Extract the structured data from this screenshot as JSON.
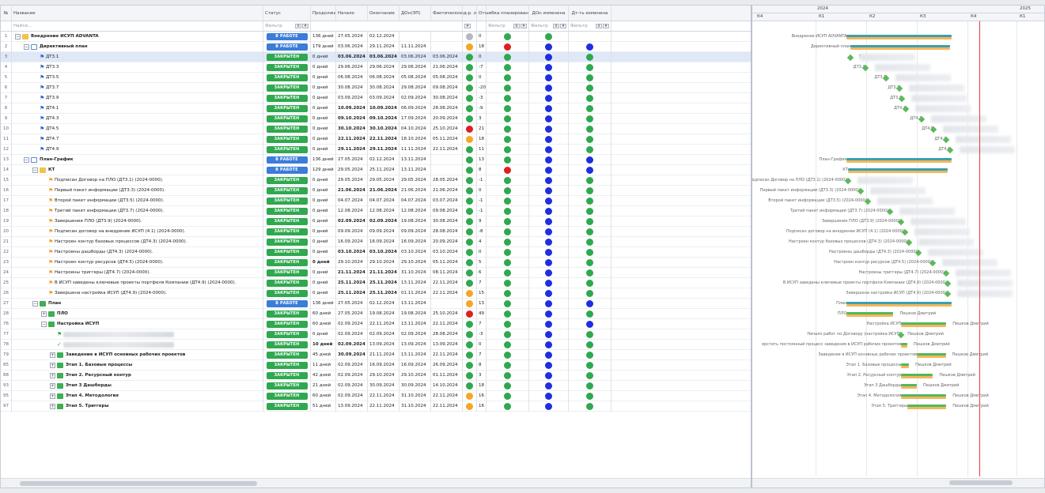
{
  "columns": {
    "num": "№",
    "name": "Название",
    "status": "Статус",
    "duration": "Продолжительность",
    "start": "Начало",
    "end": "Окончание",
    "dd": "ДОн(ЭП)",
    "fact": "Фактическое ок",
    "ind": "Инд-р. отк",
    "dev": "Откло",
    "err": "Ошибка планирования",
    "ddch": "ДОн изменена",
    "dtch": "Дт-ть изменена"
  },
  "filters": {
    "search_placeholder": "Найти...",
    "filter_placeholder": "Фильтр",
    "btn_x": "x",
    "btn_dd": "▾"
  },
  "status_labels": {
    "work": "В РАБОТЕ",
    "closed": "ЗАКРЫТЕН"
  },
  "colors": {
    "green": "#2fa84f",
    "blue": "#1f2ee0",
    "red": "#e01f1f",
    "orange": "#f5a623",
    "grey": "#b5b9bf"
  },
  "rows": [
    {
      "num": "1",
      "name": "Внедрение ИСУП ADVANTA",
      "level": 0,
      "icon": "folder",
      "exp": "−",
      "bold": true,
      "status": "work",
      "dur": "136 дней",
      "start": "27.05.2024",
      "end": "02.12.2024",
      "dd": "",
      "fact": "",
      "ind": "grey",
      "dev": "0",
      "err": "green",
      "ddch": "green",
      "dtch": ""
    },
    {
      "num": "2",
      "name": "Директивный план",
      "level": 1,
      "icon": "folder-open",
      "exp": "−",
      "bold": true,
      "status": "work",
      "dur": "179 дней",
      "start": "03.06.2024",
      "end": "29.11.2024",
      "dd": "11.11.2024",
      "fact": "",
      "ind": "orange",
      "dev": "18",
      "err": "red",
      "ddch": "blue",
      "dtch": "blue"
    },
    {
      "num": "3",
      "name": "ДТ3.1",
      "level": 2,
      "icon": "flag-blue",
      "bold": false,
      "sel": true,
      "status": "closed",
      "dur": "0 дней",
      "start": "03.06.2024",
      "end": "03.06.2024",
      "dd": "03.06.2024",
      "fact": "03.06.2024",
      "ind": "green",
      "dev": "0",
      "err": "green",
      "ddch": "blue",
      "dtch": "green",
      "bolddates": true
    },
    {
      "num": "4",
      "name": "ДТ3.3",
      "level": 2,
      "icon": "flag-blue",
      "status": "closed",
      "dur": "0 дней",
      "start": "29.06.2024",
      "end": "29.06.2024",
      "dd": "29.06.2024",
      "fact": "21.06.2024",
      "ind": "green",
      "dev": "-7",
      "err": "green",
      "ddch": "blue",
      "dtch": "green"
    },
    {
      "num": "5",
      "name": "ДТ3.5",
      "level": 2,
      "icon": "flag-blue",
      "status": "closed",
      "dur": "0 дней",
      "start": "06.08.2024",
      "end": "06.08.2024",
      "dd": "05.08.2024",
      "fact": "05.08.2024",
      "ind": "green",
      "dev": "0",
      "err": "green",
      "ddch": "blue",
      "dtch": "green"
    },
    {
      "num": "6",
      "name": "ДТ3.7",
      "level": 2,
      "icon": "flag-blue",
      "status": "closed",
      "dur": "0 дней",
      "start": "30.08.2024",
      "end": "30.08.2024",
      "dd": "29.08.2024",
      "fact": "09.08.2024",
      "ind": "green",
      "dev": "-20",
      "err": "green",
      "ddch": "blue",
      "dtch": "green"
    },
    {
      "num": "7",
      "name": "ДТ3.9",
      "level": 2,
      "icon": "flag-blue",
      "status": "closed",
      "dur": "0 дней",
      "start": "03.09.2024",
      "end": "03.09.2024",
      "dd": "02.09.2024",
      "fact": "30.08.2024",
      "ind": "green",
      "dev": "-3",
      "err": "green",
      "ddch": "blue",
      "dtch": "green"
    },
    {
      "num": "8",
      "name": "ДТ4.1",
      "level": 2,
      "icon": "flag-blue",
      "status": "closed",
      "dur": "0 дней",
      "start": "10.09.2024",
      "end": "10.09.2024",
      "dd": "06.09.2024",
      "fact": "28.08.2024",
      "ind": "green",
      "dev": "-9",
      "err": "green",
      "ddch": "blue",
      "dtch": "green",
      "bolddates": true
    },
    {
      "num": "9",
      "name": "ДТ4.3",
      "level": 2,
      "icon": "flag-blue",
      "status": "closed",
      "dur": "0 дней",
      "start": "09.10.2024",
      "end": "09.10.2024",
      "dd": "17.09.2024",
      "fact": "20.09.2024",
      "ind": "green",
      "dev": "3",
      "err": "green",
      "ddch": "blue",
      "dtch": "green",
      "bolddates": true
    },
    {
      "num": "10",
      "name": "ДТ4.5",
      "level": 2,
      "icon": "flag-blue",
      "status": "closed",
      "dur": "0 дней",
      "start": "30.10.2024",
      "end": "30.10.2024",
      "dd": "04.10.2024",
      "fact": "25.10.2024",
      "ind": "red",
      "dev": "21",
      "err": "green",
      "ddch": "blue",
      "dtch": "green",
      "bolddates": true
    },
    {
      "num": "11",
      "name": "ДТ4.7",
      "level": 2,
      "icon": "flag-blue",
      "status": "closed",
      "dur": "0 дней",
      "start": "22.11.2024",
      "end": "22.11.2024",
      "dd": "18.10.2024",
      "fact": "05.11.2024",
      "ind": "orange",
      "dev": "18",
      "err": "green",
      "ddch": "blue",
      "dtch": "green",
      "bolddates": true
    },
    {
      "num": "12",
      "name": "ДТ4.9",
      "level": 2,
      "icon": "flag-blue",
      "status": "closed",
      "dur": "0 дней",
      "start": "29.11.2024",
      "end": "29.11.2024",
      "dd": "11.11.2024",
      "fact": "22.11.2024",
      "ind": "green",
      "dev": "11",
      "err": "green",
      "ddch": "blue",
      "dtch": "green",
      "bolddates": true
    },
    {
      "num": "13",
      "name": "План-График",
      "level": 1,
      "icon": "folder-open",
      "exp": "−",
      "bold": true,
      "status": "work",
      "dur": "136 дней",
      "start": "27.05.2024",
      "end": "02.12.2024",
      "dd": "13.11.2024",
      "fact": "",
      "ind": "green",
      "dev": "13",
      "err": "green",
      "ddch": "blue",
      "dtch": "blue"
    },
    {
      "num": "14",
      "name": "КТ",
      "level": 2,
      "icon": "folder",
      "exp": "−",
      "bold": true,
      "status": "work",
      "dur": "129 дней",
      "start": "29.05.2024",
      "end": "25.11.2024",
      "dd": "13.11.2024",
      "fact": "",
      "ind": "green",
      "dev": "8",
      "err": "red",
      "ddch": "blue",
      "dtch": "blue"
    },
    {
      "num": "15",
      "name": "Подписан Договор на ПЛО (ДТ3.1) (2024-0000).",
      "level": 3,
      "icon": "flag-orange",
      "status": "closed",
      "dur": "0 дней",
      "start": "29.05.2024",
      "end": "29.05.2024",
      "dd": "29.05.2024",
      "fact": "28.05.2024",
      "ind": "green",
      "dev": "-1",
      "err": "green",
      "ddch": "blue",
      "dtch": "green"
    },
    {
      "num": "16",
      "name": "Первый пакет информации (ДТ3.3) (2024-0000).",
      "level": 3,
      "icon": "flag-orange",
      "status": "closed",
      "dur": "0 дней",
      "start": "21.06.2024",
      "end": "21.06.2024",
      "dd": "21.06.2024",
      "fact": "21.06.2024",
      "ind": "green",
      "dev": "0",
      "err": "green",
      "ddch": "blue",
      "dtch": "green",
      "bolddates": true
    },
    {
      "num": "17",
      "name": "Второй пакет информации (ДТ3.5) (2024-0000).",
      "level": 3,
      "icon": "flag-orange",
      "status": "closed",
      "dur": "0 дней",
      "start": "04.07.2024",
      "end": "04.07.2024",
      "dd": "04.07.2024",
      "fact": "03.07.2024",
      "ind": "green",
      "dev": "-1",
      "err": "green",
      "ddch": "blue",
      "dtch": "green"
    },
    {
      "num": "18",
      "name": "Третий пакет информации (ДТ3.7) (2024-0000).",
      "level": 3,
      "icon": "flag-orange",
      "status": "closed",
      "dur": "0 дней",
      "start": "12.08.2024",
      "end": "12.08.2024",
      "dd": "12.08.2024",
      "fact": "09.08.2024",
      "ind": "green",
      "dev": "-1",
      "err": "green",
      "ddch": "blue",
      "dtch": "green"
    },
    {
      "num": "19",
      "name": "Завершение ПЛО (ДТ3.9) (2024-0000).",
      "level": 3,
      "icon": "flag-orange",
      "status": "closed",
      "dur": "0 дней",
      "start": "02.09.2024",
      "end": "02.09.2024",
      "dd": "19.08.2024",
      "fact": "30.08.2024",
      "ind": "green",
      "dev": "9",
      "err": "green",
      "ddch": "blue",
      "dtch": "green",
      "bolddates": true
    },
    {
      "num": "20",
      "name": "Подписан договор на внедрение ИСУП (4.1) (2024-0000).",
      "level": 3,
      "icon": "flag-orange",
      "status": "closed",
      "dur": "0 дней",
      "start": "09.09.2024",
      "end": "09.09.2024",
      "dd": "09.09.2024",
      "fact": "28.08.2024",
      "ind": "green",
      "dev": "-8",
      "err": "green",
      "ddch": "blue",
      "dtch": "green"
    },
    {
      "num": "21",
      "name": "Настроен контур базовых процессов (ДТ4.3) (2024-0000).",
      "level": 3,
      "icon": "flag-orange",
      "status": "closed",
      "dur": "0 дней",
      "start": "16.09.2024",
      "end": "16.09.2024",
      "dd": "16.09.2024",
      "fact": "20.09.2024",
      "ind": "green",
      "dev": "4",
      "err": "green",
      "ddch": "blue",
      "dtch": "green"
    },
    {
      "num": "22",
      "name": "Настроены дашборды (ДТ4.3) (2024-0000).",
      "level": 3,
      "icon": "flag-orange",
      "status": "closed",
      "dur": "0 дней",
      "start": "03.10.2024",
      "end": "03.10.2024",
      "dd": "03.10.2024",
      "fact": "03.10.2024",
      "ind": "green",
      "dev": "0",
      "err": "green",
      "ddch": "blue",
      "dtch": "green",
      "bolddates": true
    },
    {
      "num": "23",
      "name": "Настроен контур ресурсов (ДТ4.5) (2024-0000).",
      "level": 3,
      "icon": "flag-orange",
      "status": "closed",
      "dur": "0 дней",
      "start": "29.10.2024",
      "end": "29.10.2024",
      "dd": "29.10.2024",
      "fact": "05.11.2024",
      "ind": "green",
      "dev": "5",
      "err": "green",
      "ddch": "blue",
      "dtch": "green",
      "bolddur": true
    },
    {
      "num": "24",
      "name": "Настроены триггеры (ДТ4.7) (2024-0000).",
      "level": 3,
      "icon": "flag-orange",
      "status": "closed",
      "dur": "0 дней",
      "start": "21.11.2024",
      "end": "21.11.2024",
      "dd": "31.10.2024",
      "fact": "08.11.2024",
      "ind": "green",
      "dev": "6",
      "err": "green",
      "ddch": "blue",
      "dtch": "green",
      "bolddates": true
    },
    {
      "num": "25",
      "name": "В ИСУП заведены ключевые проекты портфеля Компании (ДТ4.9) (2024-0000).",
      "level": 3,
      "icon": "flag-orange",
      "status": "closed",
      "dur": "0 дней",
      "start": "25.11.2024",
      "end": "25.11.2024",
      "dd": "13.11.2024",
      "fact": "22.11.2024",
      "ind": "green",
      "dev": "7",
      "err": "green",
      "ddch": "blue",
      "dtch": "green",
      "bolddates": true
    },
    {
      "num": "26",
      "name": "Завершена настройка ИСУП (ДТ4.9) (2024-0000).",
      "level": 3,
      "icon": "flag-orange",
      "status": "closed",
      "dur": "0 дней",
      "start": "25.11.2024",
      "end": "25.11.2024",
      "dd": "01.11.2024",
      "fact": "22.11.2024",
      "ind": "orange",
      "dev": "15",
      "err": "green",
      "ddch": "blue",
      "dtch": "green",
      "bolddates": true
    },
    {
      "num": "27",
      "name": "План",
      "level": 2,
      "icon": "folder-green",
      "exp": "−",
      "bold": true,
      "status": "work",
      "dur": "136 дней",
      "start": "27.05.2024",
      "end": "02.12.2024",
      "dd": "13.11.2024",
      "fact": "",
      "ind": "orange",
      "dev": "13",
      "err": "green",
      "ddch": "blue",
      "dtch": "blue"
    },
    {
      "num": "28",
      "name": "ПЛО",
      "level": 3,
      "icon": "folder-green",
      "exp": "+",
      "bold": true,
      "status": "closed",
      "dur": "60 дней",
      "start": "27.05.2024",
      "end": "19.08.2024",
      "dd": "19.08.2024",
      "fact": "25.10.2024",
      "ind": "red",
      "dev": "49",
      "err": "green",
      "ddch": "blue",
      "dtch": "green"
    },
    {
      "num": "76",
      "name": "Настройка ИСУП",
      "level": 3,
      "icon": "folder-green",
      "exp": "−",
      "bold": true,
      "status": "closed",
      "dur": "60 дней",
      "start": "02.09.2024",
      "end": "22.11.2024",
      "dd": "13.11.2024",
      "fact": "22.11.2024",
      "ind": "green",
      "dev": "7",
      "err": "green",
      "ddch": "blue",
      "dtch": "blue"
    },
    {
      "num": "77",
      "name": "",
      "level": 4,
      "icon": "flag-green",
      "blurname": true,
      "status": "closed",
      "dur": "0 дней",
      "start": "02.09.2024",
      "end": "02.09.2024",
      "dd": "02.09.2024",
      "fact": "28.08.2024",
      "ind": "green",
      "dev": "-3",
      "err": "green",
      "ddch": "blue",
      "dtch": "green"
    },
    {
      "num": "78",
      "name": "",
      "level": 4,
      "icon": "check",
      "blurname": true,
      "status": "closed",
      "dur": "10 дней",
      "start": "02.09.2024",
      "end": "13.09.2024",
      "dd": "13.09.2024",
      "fact": "13.09.2024",
      "ind": "green",
      "dev": "0",
      "err": "green",
      "ddch": "blue",
      "dtch": "green",
      "bolddur": true,
      "boldstart": true
    },
    {
      "num": "79",
      "name": "Заведение в ИСУП основных рабочих проектов",
      "level": 4,
      "icon": "folder-green",
      "exp": "+",
      "bold": true,
      "status": "closed",
      "dur": "45 дней",
      "start": "30.09.2024",
      "end": "21.11.2024",
      "dd": "13.11.2024",
      "fact": "22.11.2024",
      "ind": "green",
      "dev": "7",
      "err": "green",
      "ddch": "blue",
      "dtch": "green",
      "boldstart": true
    },
    {
      "num": "85",
      "name": "Этап 1. Базовые процессы",
      "level": 4,
      "icon": "folder-green",
      "exp": "+",
      "bold": true,
      "status": "closed",
      "dur": "11 дней",
      "start": "02.09.2024",
      "end": "16.09.2024",
      "dd": "16.09.2024",
      "fact": "26.09.2024",
      "ind": "green",
      "dev": "8",
      "err": "green",
      "ddch": "blue",
      "dtch": "green"
    },
    {
      "num": "88",
      "name": "Этап 2. Ресурсный контур",
      "level": 4,
      "icon": "folder-green",
      "exp": "+",
      "bold": true,
      "status": "closed",
      "dur": "42 дней",
      "start": "02.09.2024",
      "end": "29.10.2024",
      "dd": "29.10.2024",
      "fact": "01.11.2024",
      "ind": "green",
      "dev": "3",
      "err": "green",
      "ddch": "blue",
      "dtch": "green"
    },
    {
      "num": "93",
      "name": "Этап 3 Дашборды",
      "level": 4,
      "icon": "folder-green",
      "exp": "+",
      "bold": true,
      "status": "closed",
      "dur": "21 дней",
      "start": "02.09.2024",
      "end": "30.09.2024",
      "dd": "30.09.2024",
      "fact": "14.10.2024",
      "ind": "green",
      "dev": "18",
      "err": "green",
      "ddch": "blue",
      "dtch": "green"
    },
    {
      "num": "95",
      "name": "Этап 4. Методология",
      "level": 4,
      "icon": "folder-green",
      "exp": "+",
      "bold": true,
      "status": "closed",
      "dur": "60 дней",
      "start": "02.09.2024",
      "end": "22.11.2024",
      "dd": "31.10.2024",
      "fact": "22.11.2024",
      "ind": "orange",
      "dev": "16",
      "err": "green",
      "ddch": "blue",
      "dtch": "green"
    },
    {
      "num": "97",
      "name": "Этап 5. Триггеры",
      "level": 4,
      "icon": "folder-green",
      "exp": "+",
      "bold": true,
      "status": "closed",
      "dur": "51 дней",
      "start": "13.09.2024",
      "end": "22.11.2024",
      "dd": "31.10.2024",
      "fact": "22.11.2024",
      "ind": "orange",
      "dev": "16",
      "err": "green",
      "ddch": "blue",
      "dtch": "green"
    }
  ],
  "gantt": {
    "years": [
      "2024",
      "2025"
    ],
    "quarters": [
      "К4",
      "К1",
      "К2",
      "К3",
      "К4",
      "К1"
    ],
    "labels": [
      "Внедрение ИСУП ADVANTA",
      "Директивный план",
      "",
      "ДТ3.3",
      "ДТ3.5",
      "ДТ3.7",
      "ДТ3.9",
      "ДТ4.1",
      "ДТ4.3",
      "ДТ4.5",
      "ДТ4.7",
      "ДТ4.9",
      "План-График",
      "КТ",
      "Подписан Договор на ПЛО (ДТ3.1) (2024-0000).",
      "Первый пакет информации (ДТ3.3) (2024-0000).",
      "Второй пакет информации (ДТ3.5) (2024-0000).",
      "Третий пакет информации (ДТ3.7) (2024-0000).",
      "Завершение ПЛО (ДТ3.9) (2024-0000).",
      "Подписан договор на внедрение ИСУП (4.1) (2024-0000).",
      "Настроен контур базовых процессов (ДТ4.3) (2024-0000).",
      "Настроены дашборды (ДТ4.3) (2024-0000).",
      "Настроен контур ресурсов (ДТ4.5) (2024-0000).",
      "Настроены триггеры (ДТ4.7) (2024-0000).",
      "В ИСУП заведены ключевые проекты портфеля Компании (ДТ4.9) (2024-0000).",
      "Завершена настройка ИСУП (ДТ4.9) (2024-0000).",
      "План",
      "ПЛО",
      "Настройка ИСУП",
      "Начало работ по Договору (настройка ИСУП)",
      "ерстить постоянный процесс заведения в ИСУП рабочих проектов",
      "Заведение в ИСУП основных рабочих проектов",
      "Этап 1. Базовые процессы",
      "Этап 2. Ресурсный контур",
      "Этап 3 Дашборды",
      "Этап 4. Методология",
      "Этап 5. Триггеры"
    ],
    "resource": "Пешков Дмитрий",
    "row3_marker": "7"
  }
}
